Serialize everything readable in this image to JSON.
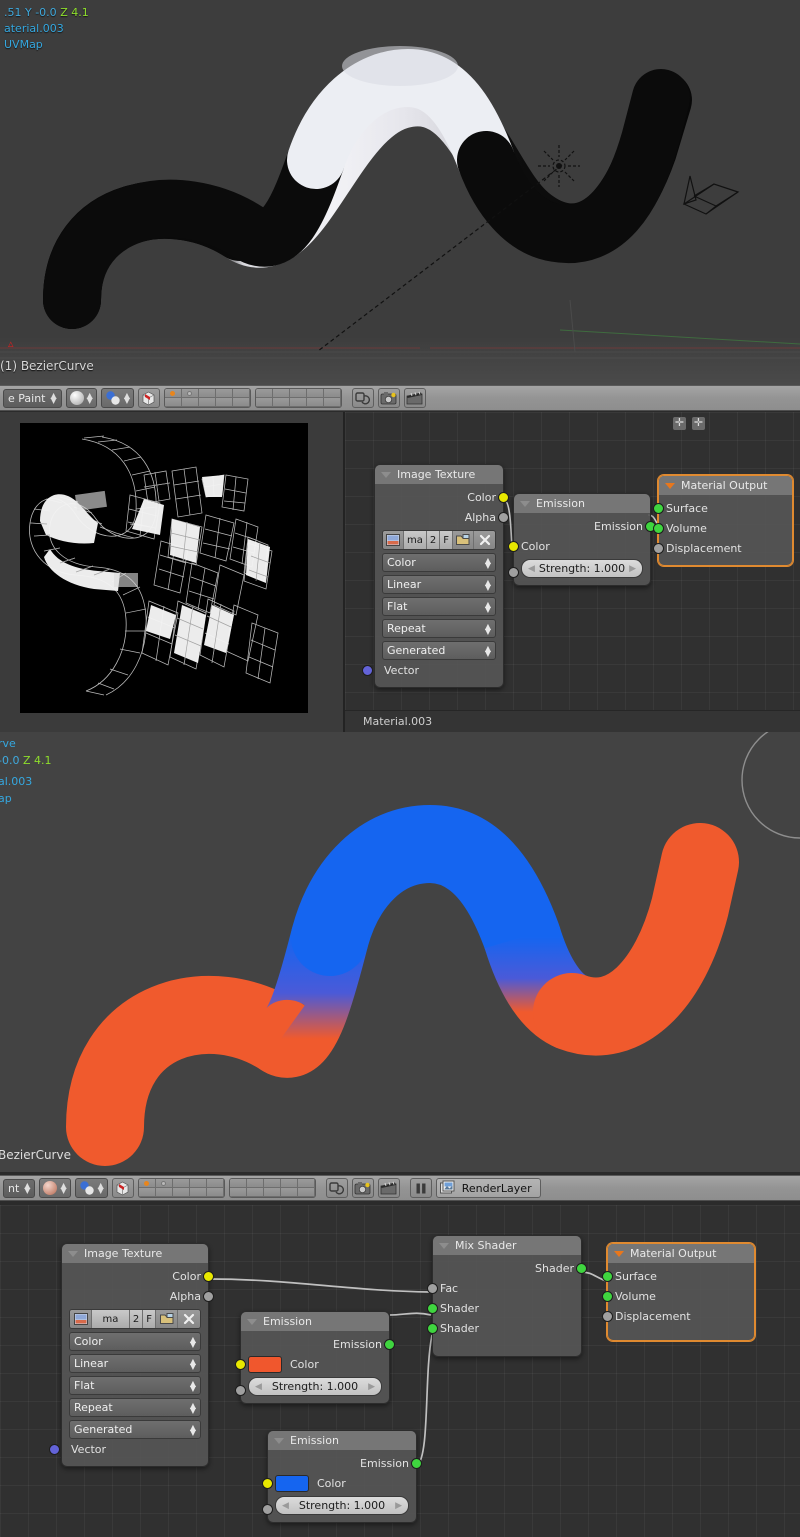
{
  "app": "blender",
  "viewport_top": {
    "coord_text": ".51 Y -0.0 Z 4.1",
    "coord_x": ".51",
    "coord_y": "Y -0.0",
    "coord_z": "Z 4.1",
    "material_text": "aterial.003",
    "uvmap_text": "UVMap",
    "object_name": "(1) BezierCurve"
  },
  "header_mid": {
    "mode": "e Paint",
    "shading": "solid-shading",
    "icons": [
      "viewport-shading-ball",
      "mode-ball",
      "snap-magnet-cube",
      "layers-block-1",
      "layers-block-2",
      "proportional-edit",
      "render-camera",
      "render-animation"
    ]
  },
  "uv_panel": {
    "name": "texture-paint-uv-image"
  },
  "node_editor_mid": {
    "footer_label": "Material.003",
    "nodes": [
      {
        "id": "image-texture",
        "title": "Image Texture",
        "outputs": [
          {
            "label": "Color",
            "color": "yellow"
          },
          {
            "label": "Alpha",
            "color": "grey"
          }
        ],
        "image_row": {
          "name": "ma",
          "users": "2",
          "fake": "F"
        },
        "enums": [
          "Color",
          "Linear",
          "Flat",
          "Repeat",
          "Generated"
        ],
        "inputs": [
          {
            "label": "Vector",
            "color": "purple"
          }
        ]
      },
      {
        "id": "emission",
        "title": "Emission",
        "outputs": [
          {
            "label": "Emission",
            "color": "green"
          }
        ],
        "inputs": [
          {
            "label": "Color",
            "color": "yellow"
          },
          {
            "label": "Strength:  1.000",
            "color": "grey"
          }
        ]
      },
      {
        "id": "material-output",
        "title": "Material Output",
        "selected": true,
        "inputs": [
          {
            "label": "Surface",
            "color": "green"
          },
          {
            "label": "Volume",
            "color": "green"
          },
          {
            "label": "Displacement",
            "color": "grey"
          }
        ]
      }
    ]
  },
  "viewport_render": {
    "line1": "rve",
    "coord_x": "-0.0",
    "coord_z": "Z 4.1",
    "material_text": "al.003",
    "uvmap_text": "ap",
    "object_name": "BezierCurve",
    "color_orange": "#f05a2d",
    "color_blue": "#1565f0"
  },
  "header_bottom": {
    "mode": "nt",
    "render_layer": "RenderLayer",
    "icons": [
      "viewport-shading-ball",
      "mode-ball",
      "snap-magnet-cube",
      "layers-block-1",
      "layers-block-2",
      "proportional-edit",
      "render-camera",
      "render-animation",
      "pause-icon",
      "renderlayer-icon"
    ]
  },
  "node_editor_bottom": {
    "nodes": [
      {
        "id": "image-texture",
        "title": "Image Texture",
        "outputs": [
          {
            "label": "Color",
            "color": "yellow"
          },
          {
            "label": "Alpha",
            "color": "grey"
          }
        ],
        "image_row": {
          "name": "ma",
          "users": "2",
          "fake": "F"
        },
        "enums": [
          "Color",
          "Linear",
          "Flat",
          "Repeat",
          "Generated"
        ],
        "inputs": [
          {
            "label": "Vector",
            "color": "purple"
          }
        ]
      },
      {
        "id": "emission-orange",
        "title": "Emission",
        "outputs": [
          {
            "label": "Emission",
            "color": "green"
          }
        ],
        "color_swatch": "#f0572d",
        "inputs": [
          {
            "label": "Color",
            "color": "yellow"
          },
          {
            "label": "Strength:  1.000",
            "color": "grey"
          }
        ]
      },
      {
        "id": "emission-blue",
        "title": "Emission",
        "outputs": [
          {
            "label": "Emission",
            "color": "green"
          }
        ],
        "color_swatch": "#1565f0",
        "inputs": [
          {
            "label": "Color",
            "color": "yellow"
          },
          {
            "label": "Strength:  1.000",
            "color": "grey"
          }
        ]
      },
      {
        "id": "mix-shader",
        "title": "Mix Shader",
        "outputs": [
          {
            "label": "Shader",
            "color": "green"
          }
        ],
        "inputs": [
          {
            "label": "Fac",
            "color": "grey"
          },
          {
            "label": "Shader",
            "color": "green"
          },
          {
            "label": "Shader",
            "color": "green"
          }
        ]
      },
      {
        "id": "material-output",
        "title": "Material Output",
        "selected": true,
        "inputs": [
          {
            "label": "Surface",
            "color": "green"
          },
          {
            "label": "Volume",
            "color": "green"
          },
          {
            "label": "Displacement",
            "color": "grey"
          }
        ]
      }
    ]
  }
}
